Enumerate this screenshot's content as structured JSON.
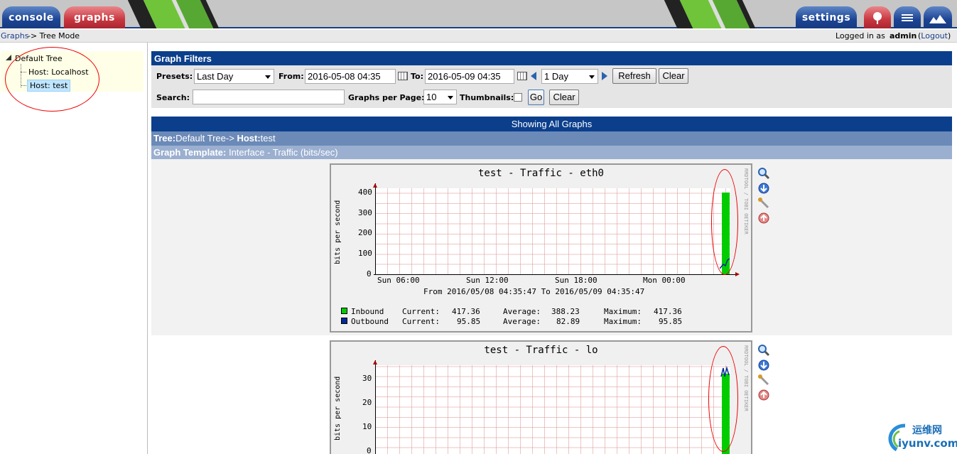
{
  "tabs": {
    "console": "console",
    "graphs": "graphs",
    "settings": "settings"
  },
  "crumb": {
    "graphs_link": "Graphs",
    "rest": " -> Tree Mode",
    "logged_prefix": "Logged in as ",
    "user": "admin",
    "logout": "Logout"
  },
  "tree": {
    "root": "Default Tree",
    "items": [
      "Host: Localhost",
      "Host: test"
    ]
  },
  "filters": {
    "title": "Graph Filters",
    "presets_label": "Presets:",
    "presets_value": "Last Day",
    "from_label": "From:",
    "from_value": "2016-05-08 04:35",
    "to_label": "To:",
    "to_value": "2016-05-09 04:35",
    "span_value": "1 Day",
    "refresh": "Refresh",
    "clear": "Clear",
    "search_label": "Search:",
    "search_value": "",
    "gpp_label": "Graphs per Page:",
    "gpp_value": "10",
    "thumbs_label": "Thumbnails:",
    "go": "Go",
    "clear2": "Clear"
  },
  "showing": "Showing All Graphs",
  "tree_row": {
    "tree_label": "Tree:",
    "tree_value": "Default Tree-> ",
    "host_label": "Host:",
    "host_value": "test"
  },
  "template_row": {
    "label": "Graph Template:",
    "value": " Interface - Traffic (bits/sec)"
  },
  "graphs": [
    {
      "title": "test - Traffic - eth0",
      "ylabel": "bits per second",
      "side": "RRDTOOL / TOBI OETIKER",
      "yticks": [
        "400",
        "300",
        "200",
        "100",
        "0"
      ],
      "xticks": [
        "Sun 06:00",
        "Sun 12:00",
        "Sun 18:00",
        "Mon 00:00"
      ],
      "range": "From 2016/05/08 04:35:47 To 2016/05/09 04:35:47",
      "legend": [
        {
          "name": "Inbound",
          "cur_l": "Current:",
          "cur": "417.36",
          "avg_l": "Average:",
          "avg": "388.23",
          "max_l": "Maximum:",
          "max": "417.36"
        },
        {
          "name": "Outbound",
          "cur_l": "Current:",
          "cur": "95.85",
          "avg_l": "Average:",
          "avg": "82.89",
          "max_l": "Maximum:",
          "max": "95.85"
        }
      ]
    },
    {
      "title": "test - Traffic - lo",
      "ylabel": "bits per second",
      "side": "RRDTOOL / TOBI OETIKER",
      "yticks": [
        "30",
        "20",
        "10",
        "0"
      ]
    }
  ],
  "colors": {
    "header": "#0b3f8c",
    "inbound": "#00cc00",
    "outbound": "#002a97",
    "tree_row": "#6c8ab8",
    "template_row": "#9bafd0"
  },
  "watermark": {
    "cn": "运维网",
    "domain": "iyunv.com"
  }
}
